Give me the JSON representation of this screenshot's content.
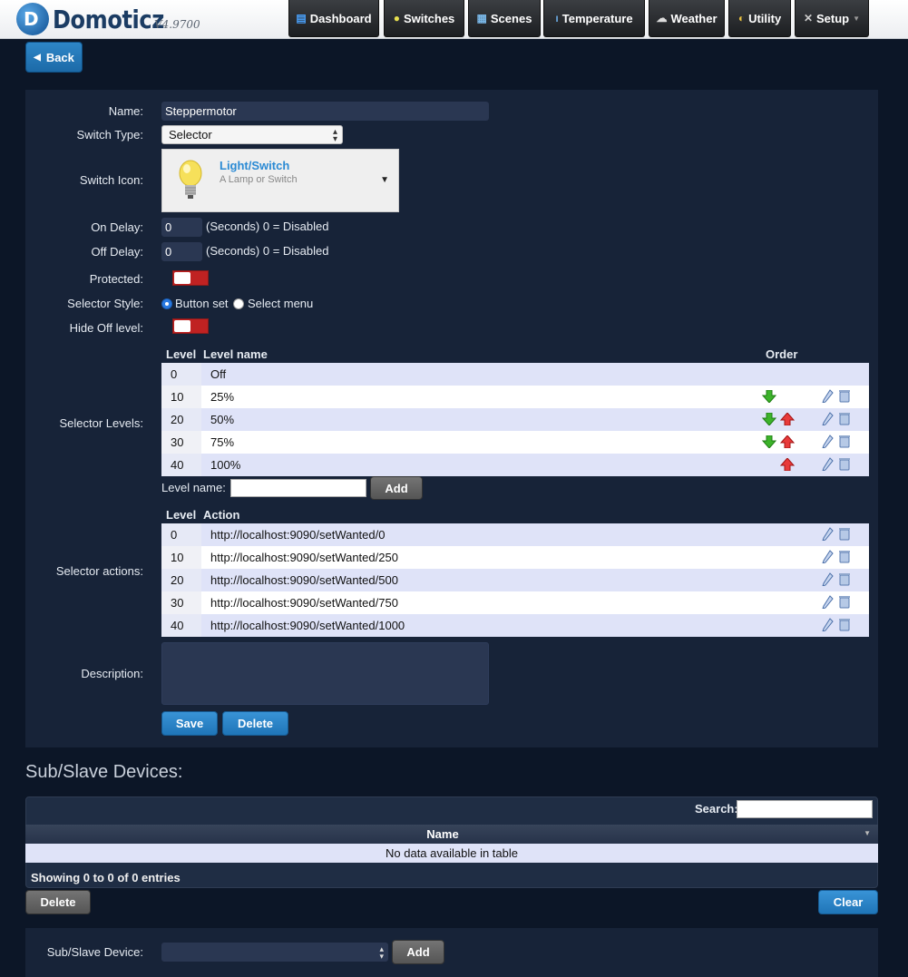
{
  "app": {
    "logo_letter": "D",
    "name": "Domoticz",
    "version": "V4.9700"
  },
  "nav": [
    {
      "label": "Dashboard",
      "icon": "dashboard-icon"
    },
    {
      "label": "Switches",
      "icon": "lightbulb-icon"
    },
    {
      "label": "Scenes",
      "icon": "clapperboard-icon"
    },
    {
      "label": "Temperature",
      "icon": "thermometer-icon"
    },
    {
      "label": "Weather",
      "icon": "cloud-icon"
    },
    {
      "label": "Utility",
      "icon": "utility-icon"
    },
    {
      "label": "Setup",
      "icon": "tools-icon"
    }
  ],
  "back_label": "Back",
  "form": {
    "name_label": "Name:",
    "name_value": "Steppermotor",
    "switch_type_label": "Switch Type:",
    "switch_type_value": "Selector",
    "switch_icon_label": "Switch Icon:",
    "icon_title": "Light/Switch",
    "icon_sub": "A Lamp or Switch",
    "on_delay_label": "On Delay:",
    "on_delay_value": "0",
    "on_delay_note": "(Seconds) 0 = Disabled",
    "off_delay_label": "Off Delay:",
    "off_delay_value": "0",
    "off_delay_note": "(Seconds) 0 = Disabled",
    "protected_label": "Protected:",
    "selector_style_label": "Selector Style:",
    "style_opt1": "Button set",
    "style_opt2": "Select menu",
    "hide_off_label": "Hide Off level:",
    "levels_label": "Selector Levels:",
    "levels_headers": {
      "level": "Level",
      "name": "Level name",
      "order": "Order"
    },
    "levels": [
      {
        "level": "0",
        "name": "Off"
      },
      {
        "level": "10",
        "name": "25%"
      },
      {
        "level": "20",
        "name": "50%"
      },
      {
        "level": "30",
        "name": "75%"
      },
      {
        "level": "40",
        "name": "100%"
      }
    ],
    "level_name_label": "Level name:",
    "add_label": "Add",
    "actions_label": "Selector actions:",
    "actions_headers": {
      "level": "Level",
      "action": "Action"
    },
    "actions": [
      {
        "level": "0",
        "action": "http://localhost:9090/setWanted/0"
      },
      {
        "level": "10",
        "action": "http://localhost:9090/setWanted/250"
      },
      {
        "level": "20",
        "action": "http://localhost:9090/setWanted/500"
      },
      {
        "level": "30",
        "action": "http://localhost:9090/setWanted/750"
      },
      {
        "level": "40",
        "action": "http://localhost:9090/setWanted/1000"
      }
    ],
    "description_label": "Description:",
    "save_label": "Save",
    "delete_label": "Delete"
  },
  "sub": {
    "title": "Sub/Slave Devices:",
    "search_label": "Search:",
    "col_name": "Name",
    "empty": "No data available in table",
    "info": "Showing 0 to 0 of 0 entries",
    "delete_label": "Delete",
    "clear_label": "Clear",
    "device_label": "Sub/Slave Device:",
    "add_label": "Add"
  }
}
